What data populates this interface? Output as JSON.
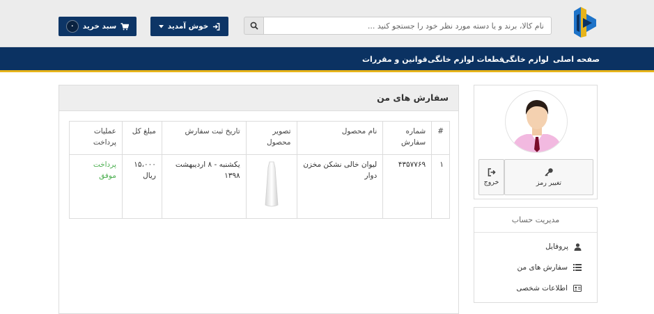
{
  "header": {
    "search": {
      "placeholder": "نام کالا، برند و یا دسته مورد نظر خود را جستجو کنید ..."
    },
    "welcome_label": "خوش آمدید",
    "cart_label": "سبد خرید",
    "cart_count": "۰"
  },
  "nav": {
    "items": [
      {
        "label": "صفحه اصلی"
      },
      {
        "label": "لوازم خانگی"
      },
      {
        "label": "قطعات لوازم خانگی"
      },
      {
        "label": "قوانین و مقررات"
      }
    ]
  },
  "orders": {
    "title": "سفارش های من",
    "columns": [
      "#",
      "شماره سفارش",
      "نام محصول",
      "تصویر محصول",
      "تاریخ ثبت سفارش",
      "مبلغ کل",
      "عملیات پرداخت"
    ],
    "rows": [
      {
        "index": "۱",
        "order_number": "۴۳۵۷۷۶۹",
        "product_name": "لیوان خالی نشکن مخزن دوار",
        "date": "یکشنبه - ۸ اردیبهشت ۱۳۹۸",
        "total": "۱۵،۰۰۰ ریال",
        "payment_status": "پرداخت موفق"
      }
    ]
  },
  "profile": {
    "change_password_label": "تغییر رمز",
    "logout_label": "خروج"
  },
  "account": {
    "title": "مدیریت حساب",
    "items": [
      {
        "label": "پروفایل",
        "icon": "user-icon"
      },
      {
        "label": "سفارش های من",
        "icon": "list-icon"
      },
      {
        "label": "اطلاعات شخصی",
        "icon": "id-card-icon"
      }
    ]
  },
  "colors": {
    "navy": "#0b3262",
    "accent": "#e7b41b",
    "success": "#4caf50"
  }
}
